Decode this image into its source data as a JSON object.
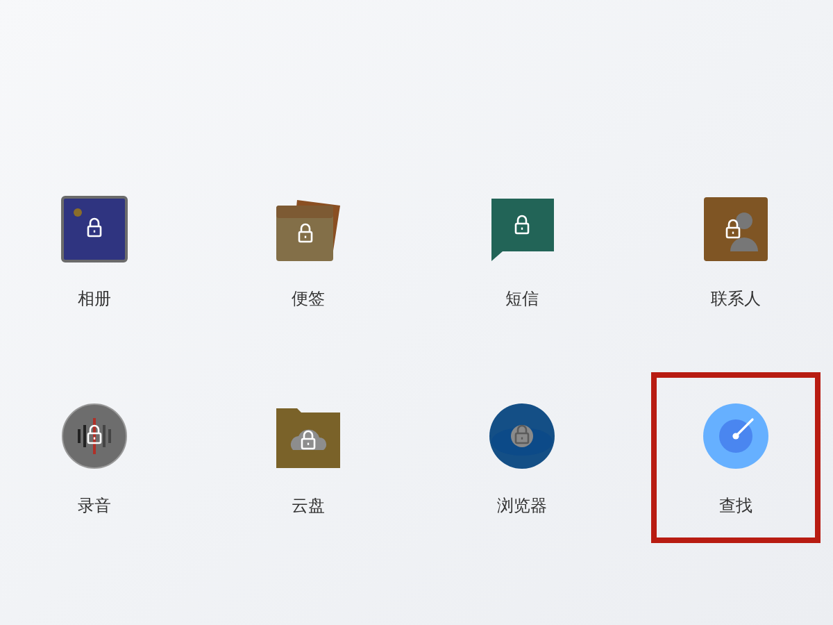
{
  "apps": [
    {
      "label": "相册",
      "kind": "photos",
      "locked": true,
      "selected": false
    },
    {
      "label": "便签",
      "kind": "notes",
      "locked": true,
      "selected": false
    },
    {
      "label": "短信",
      "kind": "messages",
      "locked": true,
      "selected": false
    },
    {
      "label": "联系人",
      "kind": "contacts",
      "locked": true,
      "selected": false
    },
    {
      "label": "录音",
      "kind": "recorder",
      "locked": true,
      "selected": false
    },
    {
      "label": "云盘",
      "kind": "cloud",
      "locked": true,
      "selected": false
    },
    {
      "label": "浏览器",
      "kind": "browser",
      "locked": true,
      "selected": false
    },
    {
      "label": "查找",
      "kind": "find",
      "locked": false,
      "selected": true
    }
  ]
}
